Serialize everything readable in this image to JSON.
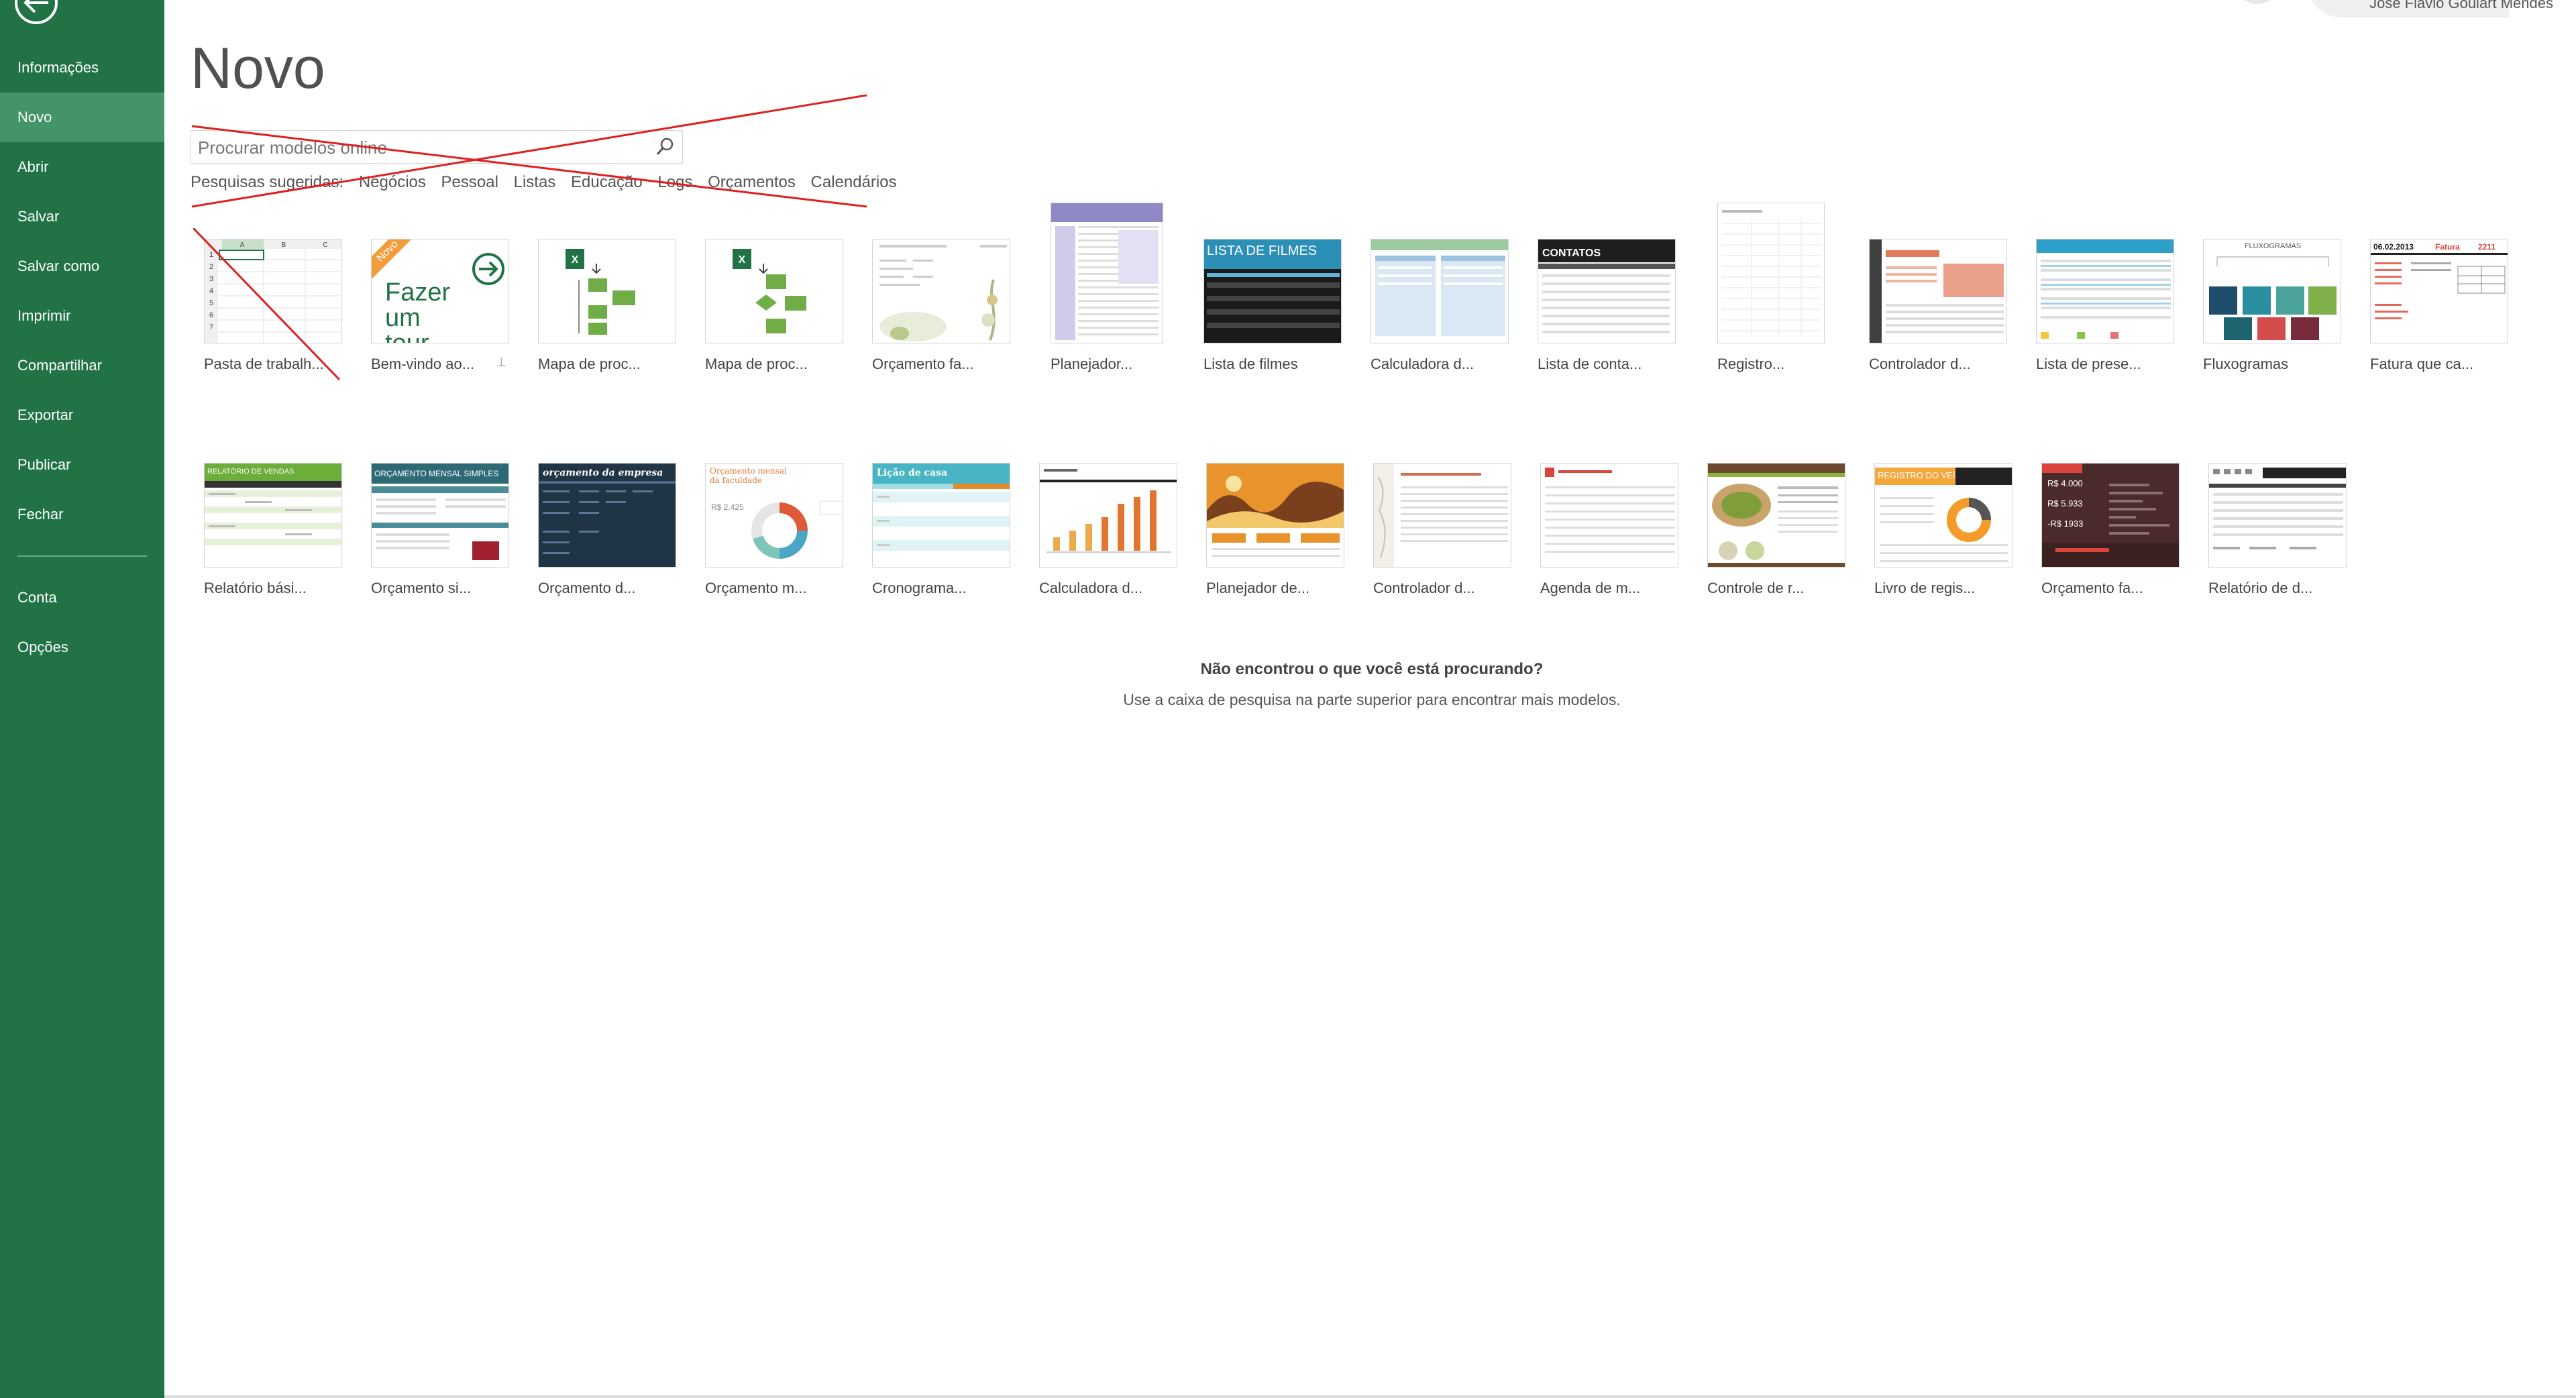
{
  "sidebar": {
    "items": [
      {
        "label": "Informações"
      },
      {
        "label": "Novo"
      },
      {
        "label": "Abrir"
      },
      {
        "label": "Salvar"
      },
      {
        "label": "Salvar como"
      },
      {
        "label": "Imprimir"
      },
      {
        "label": "Compartilhar"
      },
      {
        "label": "Exportar"
      },
      {
        "label": "Publicar"
      },
      {
        "label": "Fechar"
      }
    ],
    "bottom_items": [
      {
        "label": "Conta"
      },
      {
        "label": "Opções"
      }
    ],
    "active": "Novo"
  },
  "user": {
    "name": "José Flávio Goulart Mendes"
  },
  "page": {
    "title": "Novo"
  },
  "search": {
    "placeholder": "Procurar modelos online"
  },
  "suggested": {
    "label": "Pesquisas sugeridas:",
    "links": [
      "Negócios",
      "Pessoal",
      "Listas",
      "Educação",
      "Logs",
      "Orçamentos",
      "Calendários"
    ]
  },
  "templates_row1": [
    {
      "label": "Pasta de trabalh..."
    },
    {
      "label": "Bem-vindo ao..."
    },
    {
      "label": "Mapa de proc..."
    },
    {
      "label": "Mapa de proc..."
    },
    {
      "label": "Orçamento fa..."
    },
    {
      "label": "Planejador..."
    },
    {
      "label": "Lista de filmes"
    },
    {
      "label": "Calculadora d..."
    },
    {
      "label": "Lista de conta..."
    },
    {
      "label": "Registro..."
    },
    {
      "label": "Controlador d..."
    },
    {
      "label": "Lista de prese..."
    },
    {
      "label": "Fluxogramas"
    },
    {
      "label": "Fatura que ca..."
    }
  ],
  "templates_row2": [
    {
      "label": "Relatório bási..."
    },
    {
      "label": "Orçamento si..."
    },
    {
      "label": "Orçamento d..."
    },
    {
      "label": "Orçamento m..."
    },
    {
      "label": "Cronograma..."
    },
    {
      "label": "Calculadora d..."
    },
    {
      "label": "Planejador de..."
    },
    {
      "label": "Controlador d..."
    },
    {
      "label": "Agenda de m..."
    },
    {
      "label": "Controle de r..."
    },
    {
      "label": "Livro de regis..."
    },
    {
      "label": "Orçamento fa..."
    },
    {
      "label": "Relatório de d..."
    }
  ],
  "thumb_text": {
    "tour_badge": "Novo",
    "tour_title": "Fazer um tour",
    "movies": "LISTA DE FILMES",
    "contacts": "CONTATOS",
    "flow": "FLUXOGRAMAS",
    "invoice_date": "06.02.2013",
    "invoice_word": "Fatura",
    "invoice_num": "2211",
    "sales": "RELATÓRIO DE VENDAS",
    "simple_budget": "ORÇAMENTO MENSAL SIMPLES",
    "company_budget": "orçamento da empresa",
    "college_budget": "Orçamento mensal da faculdade",
    "college_value": "R$ 2.425",
    "homework": "Lição de casa",
    "vehicle": "REGISTRO DO VEÍCULO",
    "family_v1": "R$ 4.000",
    "family_v2": "R$ 5.933",
    "family_v3": "-R$ 1933"
  },
  "empty_state": {
    "title": "Não encontrou o que você está procurando?",
    "hint": "Use a caixa de pesquisa na parte superior para encontrar mais modelos."
  },
  "colors": {
    "sidebar": "#217346",
    "active": "#439467",
    "strike": "#e02020"
  }
}
